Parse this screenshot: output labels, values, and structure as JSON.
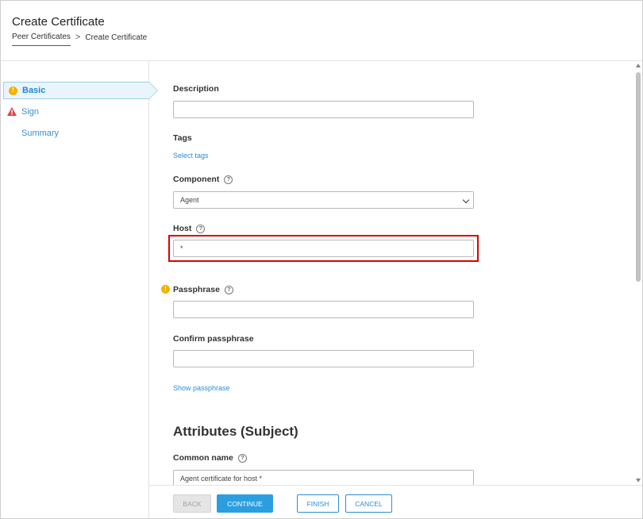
{
  "header": {
    "title": "Create Certificate",
    "breadcrumb": {
      "parent": "Peer Certificates",
      "separator": ">",
      "current": "Create Certificate"
    }
  },
  "sidebar": {
    "steps": [
      {
        "label": "Basic",
        "status_icon": "warning-circle-icon",
        "active": true
      },
      {
        "label": "Sign",
        "status_icon": "error-triangle-icon",
        "active": false
      },
      {
        "label": "Summary",
        "status_icon": "",
        "active": false
      }
    ]
  },
  "form": {
    "description": {
      "label": "Description",
      "value": ""
    },
    "tags": {
      "label": "Tags",
      "link": "Select tags"
    },
    "component": {
      "label": "Component",
      "selected": "Agent"
    },
    "host": {
      "label": "Host",
      "value": "*"
    },
    "passphrase": {
      "label": "Passphrase",
      "value": ""
    },
    "confirm_passphrase": {
      "label": "Confirm passphrase",
      "value": ""
    },
    "show_passphrase": "Show passphrase",
    "attributes_heading": "Attributes (Subject)",
    "common_name": {
      "label": "Common name",
      "value": "Agent certificate for host *"
    }
  },
  "footer": {
    "back": "BACK",
    "continue": "CONTINUE",
    "finish": "FINISH",
    "cancel": "CANCEL"
  },
  "colors": {
    "accent": "#2b9ee0",
    "link": "#2b8fd6",
    "warning": "#f2b200",
    "error": "#e04646",
    "highlight": "#e00000"
  }
}
